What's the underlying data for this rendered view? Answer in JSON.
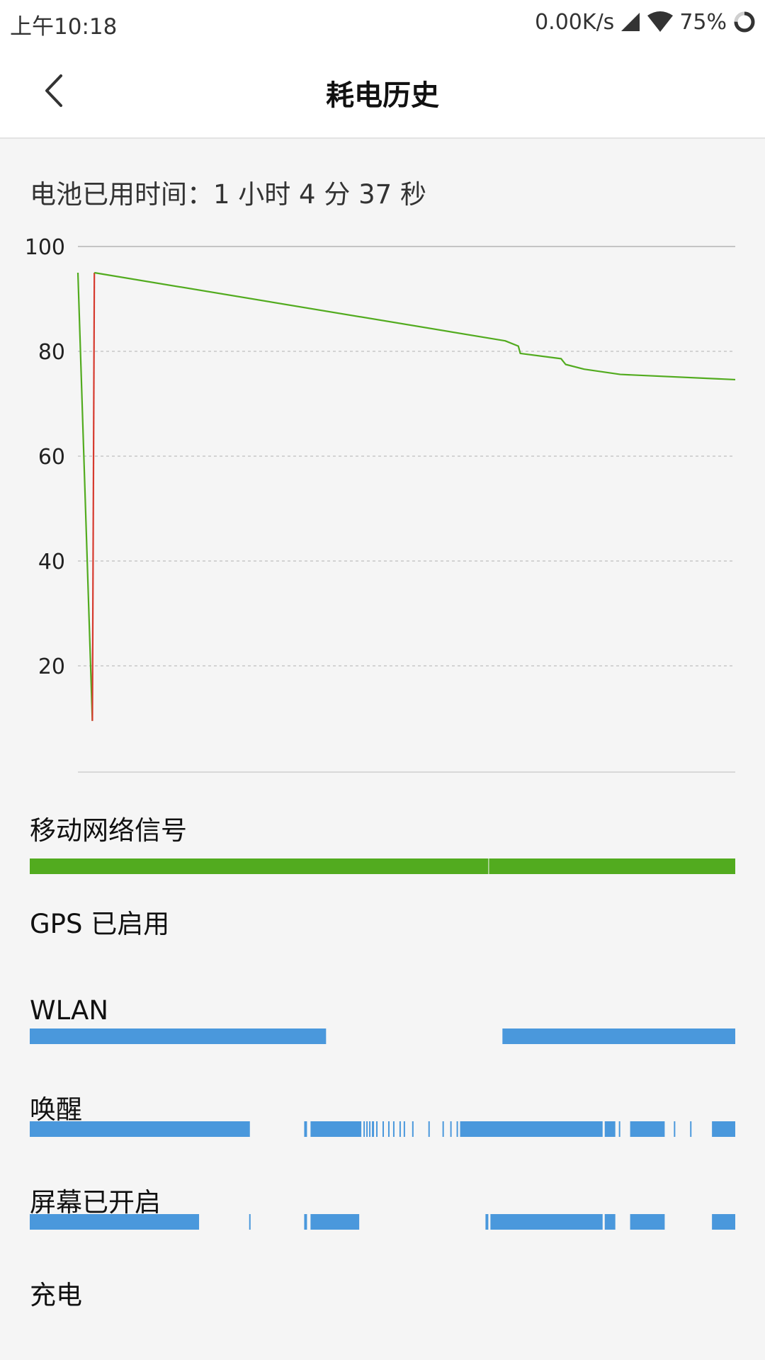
{
  "status_bar": {
    "time": "上午10:18",
    "net_speed": "0.00K/s",
    "battery_percent": "75%",
    "battery_level": 0.75,
    "icons": [
      "signal-icon",
      "wifi-icon",
      "battery-ring-icon"
    ]
  },
  "header": {
    "title": "耗电历史",
    "back_icon": "chevron-left-icon"
  },
  "battery_usage": {
    "label": "电池已用时间：1 小时 4 分 37 秒"
  },
  "colors": {
    "line_green": "#52ab1f",
    "line_red": "#d63a2e",
    "bar_green": "#52ab1f",
    "bar_blue": "#4a98dc",
    "grid": "#c8c8c8"
  },
  "chart_data": {
    "type": "line",
    "y_ticks": [
      "100",
      "80",
      "60",
      "40",
      "20"
    ],
    "ylim": [
      0,
      100
    ],
    "xlim": [
      0,
      100
    ],
    "grid": true,
    "series": [
      {
        "color": "#52ab1f",
        "points": [
          [
            0,
            95
          ],
          [
            2.2,
            9.5
          ]
        ]
      },
      {
        "color": "#d63a2e",
        "points": [
          [
            2.2,
            9.5
          ],
          [
            2.5,
            95
          ]
        ]
      },
      {
        "color": "#52ab1f",
        "points": [
          [
            2.5,
            95
          ],
          [
            65,
            82
          ],
          [
            67,
            81
          ],
          [
            67.3,
            79.6
          ],
          [
            73.5,
            78.6
          ],
          [
            74.2,
            77.5
          ],
          [
            77,
            76.6
          ],
          [
            82.5,
            75.6
          ],
          [
            100,
            74.6
          ]
        ]
      }
    ]
  },
  "sections": {
    "mobile_signal": {
      "label": "移动网络信号",
      "segments": [
        [
          0,
          0.65
        ],
        [
          0.651,
          1
        ]
      ],
      "color": "#52ab1f"
    },
    "gps": {
      "label": "GPS 已启用",
      "segments": []
    },
    "wlan": {
      "label": "WLAN",
      "segments": [
        [
          0,
          0.42
        ],
        [
          0.67,
          1
        ]
      ]
    },
    "wake": {
      "label": "唤醒",
      "segments": [
        [
          0,
          0.312
        ],
        [
          0.389,
          0.393
        ],
        [
          0.398,
          0.47
        ],
        [
          0.473,
          0.475
        ],
        [
          0.477,
          0.479
        ],
        [
          0.481,
          0.483
        ],
        [
          0.485,
          0.488
        ],
        [
          0.491,
          0.493
        ],
        [
          0.5,
          0.502
        ],
        [
          0.508,
          0.51
        ],
        [
          0.515,
          0.517
        ],
        [
          0.524,
          0.526
        ],
        [
          0.53,
          0.532
        ],
        [
          0.542,
          0.544
        ],
        [
          0.565,
          0.567
        ],
        [
          0.585,
          0.587
        ],
        [
          0.596,
          0.598
        ],
        [
          0.605,
          0.607
        ],
        [
          0.61,
          0.812
        ],
        [
          0.815,
          0.83
        ],
        [
          0.835,
          0.837
        ],
        [
          0.851,
          0.9
        ],
        [
          0.913,
          0.915
        ],
        [
          0.936,
          0.938
        ],
        [
          0.967,
          1
        ]
      ]
    },
    "screen_on": {
      "label": "屏幕已开启",
      "segments": [
        [
          0,
          0.24
        ],
        [
          0.311,
          0.313
        ],
        [
          0.389,
          0.393
        ],
        [
          0.398,
          0.467
        ],
        [
          0.646,
          0.65
        ],
        [
          0.653,
          0.812
        ],
        [
          0.815,
          0.83
        ],
        [
          0.851,
          0.9
        ],
        [
          0.967,
          1
        ]
      ]
    },
    "charging": {
      "label": "充电",
      "segments": []
    }
  }
}
